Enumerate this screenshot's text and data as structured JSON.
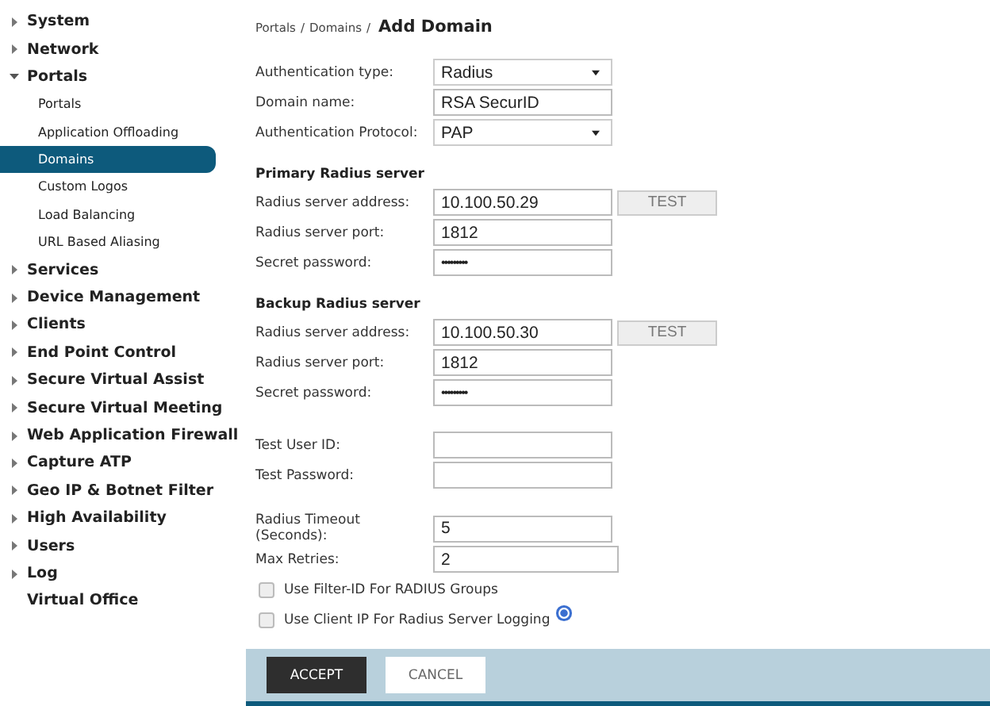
{
  "sidebar": {
    "items": [
      {
        "label": "System",
        "kind": "group",
        "expanded": false
      },
      {
        "label": "Network",
        "kind": "group",
        "expanded": false
      },
      {
        "label": "Portals",
        "kind": "group",
        "expanded": true,
        "children": [
          {
            "label": "Portals",
            "selected": false
          },
          {
            "label": "Application Offloading",
            "selected": false
          },
          {
            "label": "Domains",
            "selected": true
          },
          {
            "label": "Custom Logos",
            "selected": false
          },
          {
            "label": "Load Balancing",
            "selected": false
          },
          {
            "label": "URL Based Aliasing",
            "selected": false
          }
        ]
      },
      {
        "label": "Services",
        "kind": "group",
        "expanded": false
      },
      {
        "label": "Device Management",
        "kind": "group",
        "expanded": false
      },
      {
        "label": "Clients",
        "kind": "group",
        "expanded": false
      },
      {
        "label": "End Point Control",
        "kind": "group",
        "expanded": false
      },
      {
        "label": "Secure Virtual Assist",
        "kind": "group",
        "expanded": false
      },
      {
        "label": "Secure Virtual Meeting",
        "kind": "group",
        "expanded": false
      },
      {
        "label": "Web Application Firewall",
        "kind": "group",
        "expanded": false
      },
      {
        "label": "Capture ATP",
        "kind": "group",
        "expanded": false
      },
      {
        "label": "Geo IP & Botnet Filter",
        "kind": "group",
        "expanded": false
      },
      {
        "label": "High Availability",
        "kind": "group",
        "expanded": false
      },
      {
        "label": "Users",
        "kind": "group",
        "expanded": false
      },
      {
        "label": "Log",
        "kind": "group",
        "expanded": false
      },
      {
        "label": "Virtual Office",
        "kind": "link"
      }
    ]
  },
  "breadcrumb": [
    "Portals",
    "Domains"
  ],
  "breadcrumb_separator": "/",
  "page_title": "Add Domain",
  "sections": [
    {
      "rows": [
        {
          "label": "Authentication type:",
          "kind": "select",
          "value": "Radius"
        },
        {
          "label": "Domain name:",
          "kind": "text",
          "value": "RSA SecurID"
        },
        {
          "label": "Authentication Protocol:",
          "kind": "select",
          "value": "PAP"
        }
      ]
    },
    {
      "heading": "Primary Radius server",
      "rows": [
        {
          "label": "Radius server address:",
          "kind": "text",
          "value": "10.100.50.29",
          "button": "TEST"
        },
        {
          "label": "Radius server port:",
          "kind": "text",
          "value": "1812"
        },
        {
          "label": "Secret password:",
          "kind": "password",
          "value": "•••••••••"
        }
      ]
    },
    {
      "heading": "Backup Radius server",
      "rows": [
        {
          "label": "Radius server address:",
          "kind": "text",
          "value": "10.100.50.30",
          "button": "TEST"
        },
        {
          "label": "Radius server port:",
          "kind": "text",
          "value": "1812"
        },
        {
          "label": "Secret password:",
          "kind": "password",
          "value": "•••••••••"
        }
      ]
    },
    {
      "rows": [
        {
          "label": "Test User ID:",
          "kind": "text"
        },
        {
          "label": "Test Password:",
          "kind": "text"
        }
      ]
    },
    {
      "rows": [
        {
          "label": "Radius Timeout (Seconds):",
          "kind": "text",
          "value": "5"
        },
        {
          "label": "Max Retries:",
          "kind": "text",
          "value": "2"
        },
        {
          "label": "Use Filter-ID For RADIUS Groups",
          "kind": "checkbox",
          "checked": false
        },
        {
          "label": "Use Client IP For Radius Server Logging",
          "kind": "checkbox",
          "checked": false,
          "help": true
        }
      ]
    }
  ],
  "buttons": [
    {
      "label": "ACCEPT",
      "kind": "primary"
    },
    {
      "label": "CANCEL",
      "kind": "secondary"
    }
  ]
}
